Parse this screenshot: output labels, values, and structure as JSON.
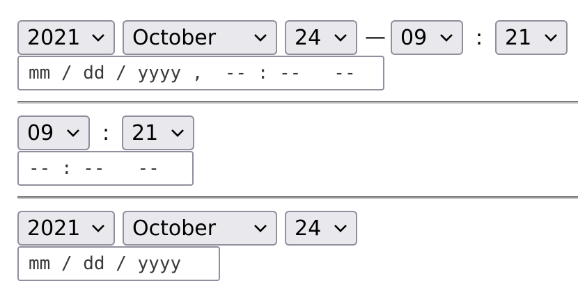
{
  "section1": {
    "year": "2021",
    "month": "October",
    "day": "24",
    "dash": "—",
    "hour": "09",
    "colon": ":",
    "minute": "21",
    "datetime_placeholder": "mm / dd / yyyy ,  -- : --   --"
  },
  "section2": {
    "hour": "09",
    "colon": ":",
    "minute": "21",
    "time_placeholder": "-- : --   --"
  },
  "section3": {
    "year": "2021",
    "month": "October",
    "day": "24",
    "date_placeholder": "mm / dd / yyyy"
  },
  "icons": {
    "dropdown": "chevron-down-icon"
  }
}
